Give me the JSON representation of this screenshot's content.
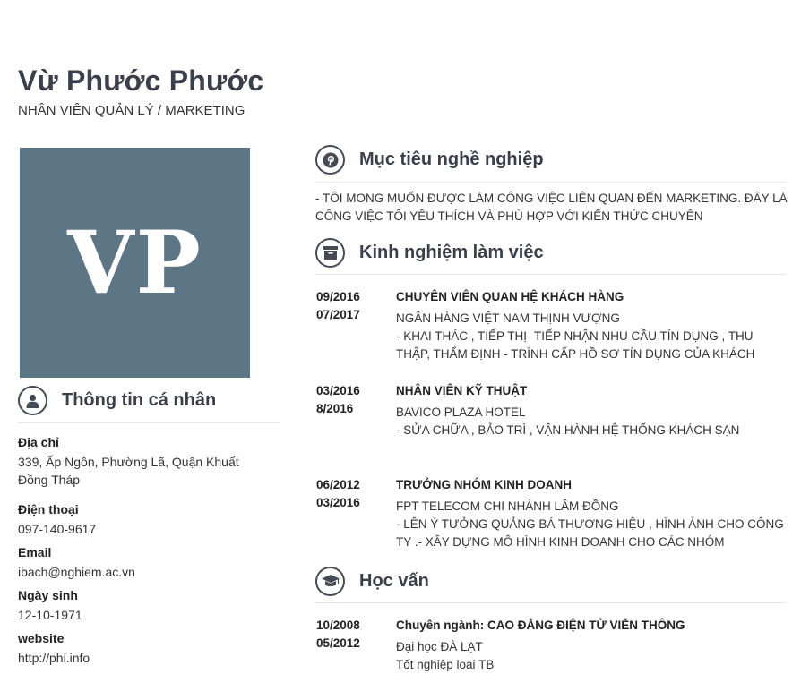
{
  "profile": {
    "name": "Vừ Phước Phước",
    "title": "NHÂN VIÊN QUẢN LÝ / MARKETING",
    "initials": "VP"
  },
  "colors": {
    "avatar_bg": "#5c7686",
    "heading": "#3a3f4b"
  },
  "personal": {
    "heading": "Thông tin cá nhân",
    "icon": "user-icon",
    "items": [
      {
        "label": "Địa chỉ",
        "value": "339, Ấp Ngôn, Phường Lã, Quận Khuất Đồng Tháp"
      },
      {
        "label": "Điện thoại",
        "value": "097-140-9617"
      },
      {
        "label": "Email",
        "value": "ibach@nghiem.ac.vn"
      },
      {
        "label": "Ngày sinh",
        "value": "12-10-1971"
      },
      {
        "label": "website",
        "value": "http://phi.info"
      }
    ]
  },
  "objective": {
    "heading": "Mục tiêu nghề nghiệp",
    "icon": "pinterest-icon",
    "text": "- TÔI MONG MUỐN ĐƯỢC LÀM CÔNG VIỆC LIÊN QUAN ĐẾN MARKETING. ĐÂY LÀ CÔNG VIỆC TÔI YÊU THÍCH VÀ PHÙ HỢP VỚI KIẾN THỨC CHUYÊN"
  },
  "experience": {
    "heading": "Kinh nghiệm làm việc",
    "icon": "archive-icon",
    "entries": [
      {
        "start": "09/2016",
        "end": "07/2017",
        "role": "CHUYÊN VIÊN QUAN HỆ KHÁCH HÀNG",
        "org": "NGÂN HÀNG VIỆT NAM THỊNH VƯỢNG",
        "desc": "- KHAI THÁC , TIẾP THỊ- TIẾP NHẬN NHU CẦU TÍN DỤNG , THU THẬP, THẨM ĐỊNH - TRÌNH CẤP HỒ SƠ TÍN DỤNG CỦA KHÁCH"
      },
      {
        "start": "03/2016",
        "end": "8/2016",
        "role": "NHÂN VIÊN KỸ THUẬT",
        "org": "BAVICO PLAZA HOTEL",
        "desc": "- SỬA CHỮA , BẢO TRÌ , VẬN HÀNH HỆ THỐNG KHÁCH SẠN"
      },
      {
        "start": "06/2012",
        "end": "03/2016",
        "role": "TRƯỞNG NHÓM KINH DOANH",
        "org": "FPT TELECOM CHI NHÁNH LÂM ĐỒNG",
        "desc": "- LÊN Ý TƯỞNG QUẢNG BÁ THƯƠNG HIỆU , HÌNH ẢNH CHO CÔNG TY .- XÂY DỰNG MÔ HÌNH KINH DOANH CHO CÁC NHÓM"
      }
    ]
  },
  "education": {
    "heading": "Học vấn",
    "icon": "graduation-cap-icon",
    "entries": [
      {
        "start": "10/2008",
        "end": "05/2012",
        "major": "Chuyên ngành: CAO ĐẲNG ĐIỆN TỬ VIỄN THÔNG",
        "school": "Đại học ĐÀ LẠT",
        "grade": "Tốt nghiệp loại TB"
      }
    ]
  }
}
